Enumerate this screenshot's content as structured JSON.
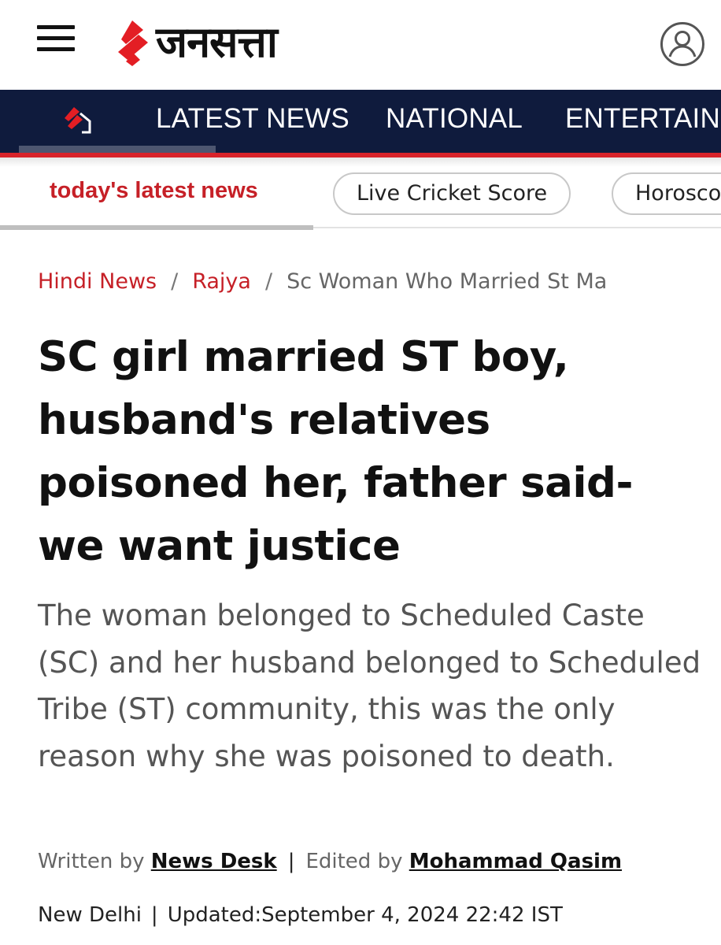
{
  "header": {
    "logo_text": "जनसत्ता",
    "brand_color": "#e31e24"
  },
  "nav": {
    "background": "#0f1b3d",
    "items": [
      {
        "label": "LATEST NEWS"
      },
      {
        "label": "NATIONAL"
      },
      {
        "label": "ENTERTAIN"
      }
    ]
  },
  "trending": {
    "title": "today's latest news",
    "pills": [
      {
        "label": "Live Cricket Score"
      },
      {
        "label": "Horosco"
      }
    ]
  },
  "breadcrumb": {
    "items": [
      {
        "label": "Hindi News"
      },
      {
        "label": "Rajya"
      }
    ],
    "separator": "/",
    "current": "Sc Woman Who Married St Ma"
  },
  "article": {
    "headline": "SC girl married ST boy, husband's relatives poisoned her, father said- we want justice",
    "summary": "The woman belonged to Scheduled Caste (SC) and her husband belonged to Scheduled Tribe (ST) community, this was the only reason why she was poisoned to death.",
    "byline": {
      "written_prefix": "Written by",
      "written_author": "News Desk",
      "separator": "|",
      "edited_prefix": "Edited by",
      "edited_author": "Mohammad Qasim"
    },
    "dateline": {
      "location": "New Delhi",
      "separator": "|",
      "updated": "Updated:September 4, 2024 22:42 IST"
    }
  },
  "icons": {
    "menu": "hamburger-menu-icon",
    "user": "user-account-icon",
    "home": "home-icon"
  }
}
